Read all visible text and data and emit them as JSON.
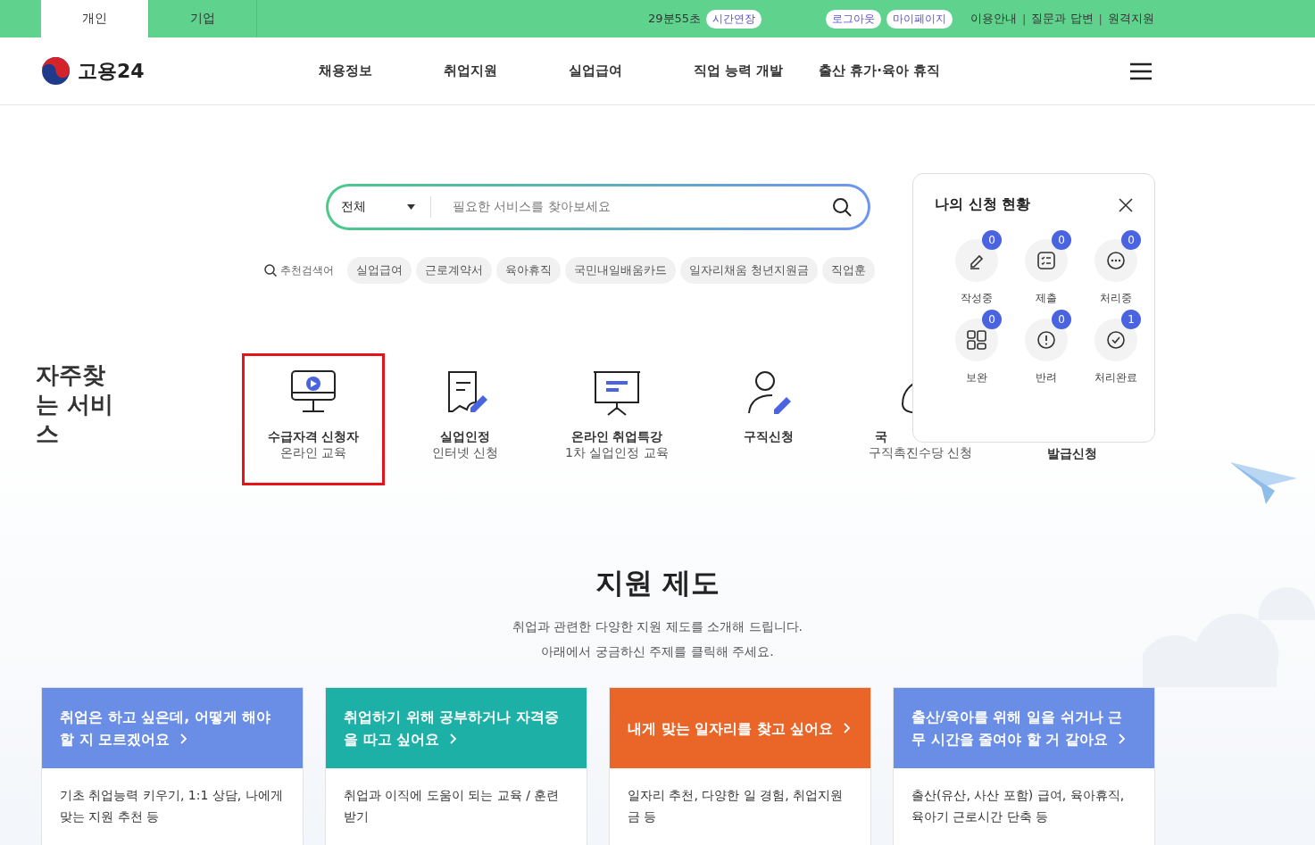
{
  "top_bar": {
    "tabs": [
      {
        "label": "개인",
        "selected": true
      },
      {
        "label": "기업",
        "selected": false
      }
    ],
    "session_timer": "29분55초",
    "extend_button": "시간연장",
    "logout_button": "로그아웃",
    "mypage_button": "마이페이지",
    "links": [
      {
        "kind": "link",
        "text": "이용안내"
      },
      {
        "kind": "separator",
        "text": "|"
      },
      {
        "kind": "link",
        "text": "질문과 답변"
      },
      {
        "kind": "separator",
        "text": "|"
      },
      {
        "kind": "link",
        "text": "원격지원"
      }
    ]
  },
  "header": {
    "logo": "고용24",
    "nav": [
      "채용정보",
      "취업지원",
      "실업급여",
      "직업 능력 개발",
      "출산 휴가·육아 휴직"
    ]
  },
  "search": {
    "category": "전체",
    "placeholder": "필요한 서비스를 찾아보세요"
  },
  "recommended": {
    "label": "추천검색어",
    "keywords": [
      "실업급여",
      "근로계약서",
      "육아휴직",
      "국민내일배움카드",
      "일자리채움 청년지원금",
      "직업훈"
    ]
  },
  "frequent_services": {
    "title": "자주찾는 서비스",
    "items": [
      {
        "kind": "monitor",
        "line1": "수급자격 신청자",
        "line2": "온라인 교육",
        "selected": true
      },
      {
        "kind": "document",
        "line1": "실업인정",
        "line2": "인터넷 신청",
        "selected": false
      },
      {
        "kind": "easel",
        "line1": "온라인 취업특강",
        "line2": "1차 실업인정 교육",
        "selected": false
      },
      {
        "kind": "person",
        "line1": "구직신청",
        "selected": false
      },
      {
        "kind": "bag",
        "line1": "국",
        "line2": "구직촉진수당 신청",
        "selected": false
      },
      {
        "kind": "none",
        "line2": "발급신청",
        "selected": false
      }
    ]
  },
  "status_popup": {
    "title": "나의 신청 현황",
    "items": [
      {
        "kind": "pencil",
        "label": "작성중",
        "count": "0"
      },
      {
        "kind": "list",
        "label": "제출",
        "count": "0"
      },
      {
        "kind": "dots",
        "label": "처리중",
        "count": "0"
      },
      {
        "kind": "grid",
        "label": "보완",
        "count": "0"
      },
      {
        "kind": "alert",
        "label": "반려",
        "count": "0"
      },
      {
        "kind": "check",
        "label": "처리완료",
        "count": "1"
      }
    ]
  },
  "support": {
    "title": "지원 제도",
    "subtitle": [
      "취업과 관련한 다양한 지원 제도를 소개해 드립니다.",
      "아래에서 궁금하신 주제를 클릭해 주세요."
    ],
    "cards": [
      {
        "title": "취업은 하고 싶은데, 어떻게 해야 할 지 모르겠어요",
        "description": "기초 취업능력 키우기, 1:1 상담, 나에게 맞는 지원 추천 등",
        "color": "#6a8de6"
      },
      {
        "title": "취업하기 위해 공부하거나 자격증을 따고 싶어요",
        "description": "취업과 이직에 도움이 되는 교육 / 훈련 받기",
        "color": "#1cb0a6"
      },
      {
        "title": "내게 맞는 일자리를 찾고 싶어요",
        "description": "일자리 추천, 다양한 일 경험, 취업지원금 등",
        "color": "#ea6628"
      },
      {
        "title": "출산/육아를 위해 일을 쉬거나 근무 시간을 줄여야 할 거 같아요",
        "description": "출산(유산, 사산 포함) 급여, 육아휴직, 육아기 근로시간 단축 등",
        "color": "#6a8de6"
      }
    ]
  }
}
